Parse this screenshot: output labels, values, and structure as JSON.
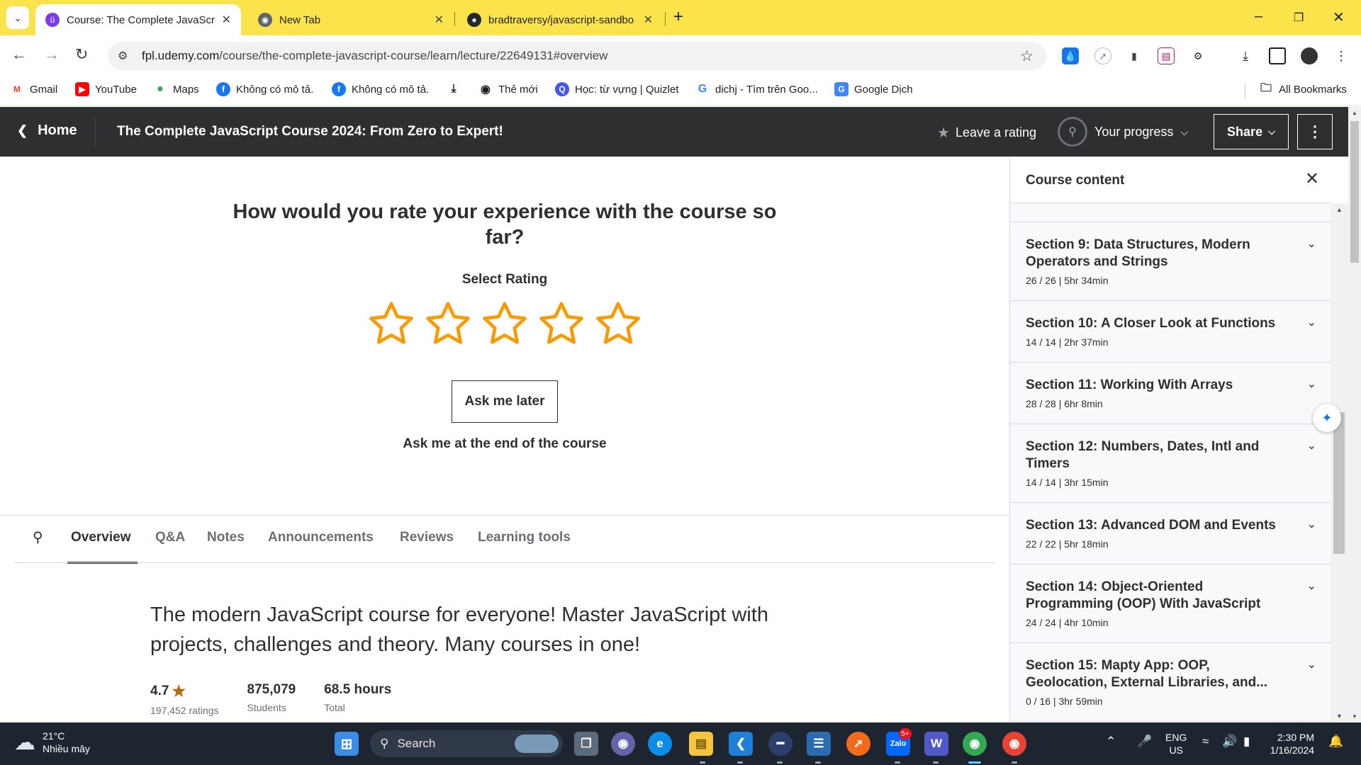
{
  "browser": {
    "tabs": [
      {
        "title": "Course: The Complete JavaScrip",
        "active": true
      },
      {
        "title": "New Tab",
        "active": false
      },
      {
        "title": "bradtraversy/javascript-sandbo",
        "active": false
      }
    ],
    "url_host": "fpl.udemy.com",
    "url_path": "/course/the-complete-javascript-course/learn/lecture/22649131#overview",
    "bookmarks": [
      {
        "label": "Gmail",
        "icon": "gmail-icon"
      },
      {
        "label": "YouTube",
        "icon": "youtube-icon"
      },
      {
        "label": "Maps",
        "icon": "maps-icon"
      },
      {
        "label": "Không có mô tả.",
        "icon": "facebook-icon"
      },
      {
        "label": "Không có mô tả.",
        "icon": "facebook-icon"
      },
      {
        "label": "",
        "icon": "download-icon"
      },
      {
        "label": "Thẻ mới",
        "icon": "globe-icon"
      },
      {
        "label": "Học: từ vựng | Quizlet",
        "icon": "quizlet-icon"
      },
      {
        "label": "dichj - Tìm trên Goo...",
        "icon": "google-icon"
      },
      {
        "label": "Google Dịch",
        "icon": "google-translate-icon"
      }
    ],
    "all_bookmarks": "All Bookmarks"
  },
  "header": {
    "home": "Home",
    "course_title": "The Complete JavaScript Course 2024: From Zero to Expert!",
    "leave_rating": "Leave a rating",
    "your_progress": "Your progress",
    "share": "Share"
  },
  "rating": {
    "question": "How would you rate your experience with the course so far?",
    "select_label": "Select Rating",
    "stars": 5,
    "selected": 0,
    "ask_later": "Ask me later",
    "ask_end": "Ask me at the end of the course"
  },
  "tabs": [
    "Overview",
    "Q&A",
    "Notes",
    "Announcements",
    "Reviews",
    "Learning tools"
  ],
  "active_tab": "Overview",
  "overview": {
    "headline": "The modern JavaScript course for everyone! Master JavaScript with projects, challenges and theory. Many courses in one!",
    "rating_value": "4.7",
    "rating_count": "197,452 ratings",
    "students_value": "875,079",
    "students_label": "Students",
    "hours_value": "68.5 hours",
    "hours_label": "Total"
  },
  "sidebar": {
    "title": "Course content",
    "sections": [
      {
        "name": "Section 9: Data Structures, Modern Operators and Strings",
        "meta": "26 / 26 | 5hr 34min"
      },
      {
        "name": "Section 10: A Closer Look at Functions",
        "meta": "14 / 14 | 2hr 37min"
      },
      {
        "name": "Section 11: Working With Arrays",
        "meta": "28 / 28 | 6hr 8min"
      },
      {
        "name": "Section 12: Numbers, Dates, Intl and Timers",
        "meta": "14 / 14 | 3hr 15min"
      },
      {
        "name": "Section 13: Advanced DOM and Events",
        "meta": "22 / 22 | 5hr 18min"
      },
      {
        "name": "Section 14: Object-Oriented Programming (OOP) With JavaScript",
        "meta": "24 / 24 | 4hr 10min"
      },
      {
        "name": "Section 15: Mapty App: OOP, Geolocation, External Libraries, and...",
        "meta": "0 / 16 | 3hr 59min"
      }
    ]
  },
  "taskbar": {
    "temperature": "21°C",
    "weather": "Nhiều mây",
    "search": "Search",
    "zalo_badge": "5+",
    "language": "ENG",
    "region": "US",
    "time": "2:30 PM",
    "date": "1/16/2024"
  },
  "colors": {
    "star": "#f69c08",
    "header_bg": "#2d2f31",
    "tabstrip_bg": "#fbe44b",
    "taskbar_bg": "#1c2530"
  }
}
